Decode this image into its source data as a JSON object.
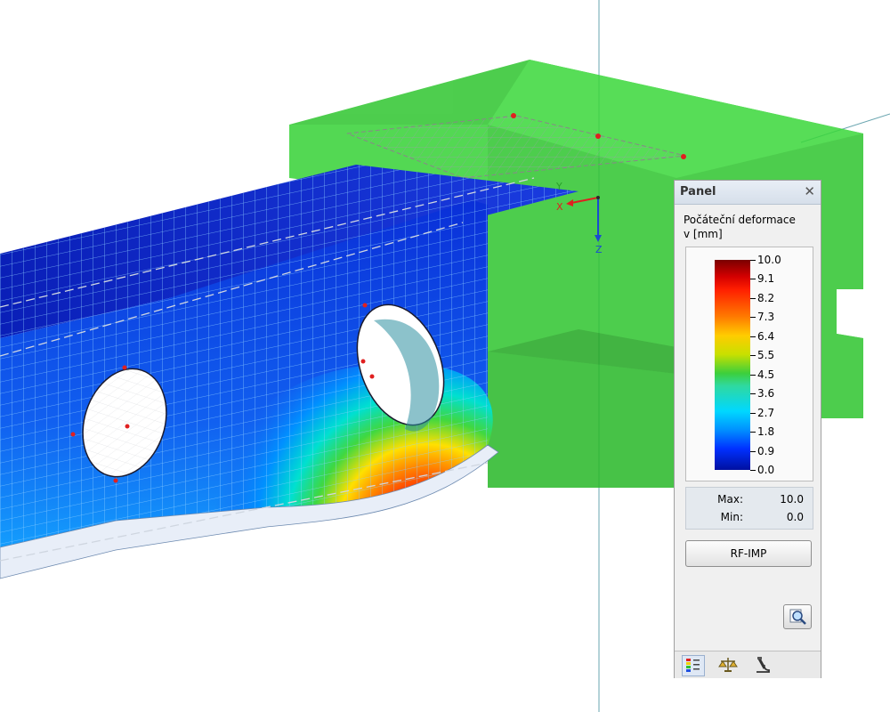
{
  "viewport": {
    "axis_x_label": "X",
    "axis_y_label": "Y",
    "axis_z_label": "Z"
  },
  "panel": {
    "title": "Panel",
    "result_title_line1": "Počáteční deformace",
    "result_title_line2": "v [mm]",
    "scale_values": [
      "10.0",
      "9.1",
      "8.2",
      "7.3",
      "6.4",
      "5.5",
      "4.5",
      "3.6",
      "2.7",
      "1.8",
      "0.9",
      "0.0"
    ],
    "max_label": "Max:",
    "max_value": "10.0",
    "min_label": "Min:",
    "min_value": "0.0",
    "rfimp_label": "RF-IMP",
    "close_icon": "close-icon",
    "zoom_icon": "magnifier-icon",
    "tabs": [
      "color-scale-icon",
      "balance-scale-icon",
      "microscope-icon"
    ]
  },
  "colors": {
    "support_green": "#29c129",
    "mesh_blue": "#0a2fd8",
    "hot_red": "#e00000"
  }
}
